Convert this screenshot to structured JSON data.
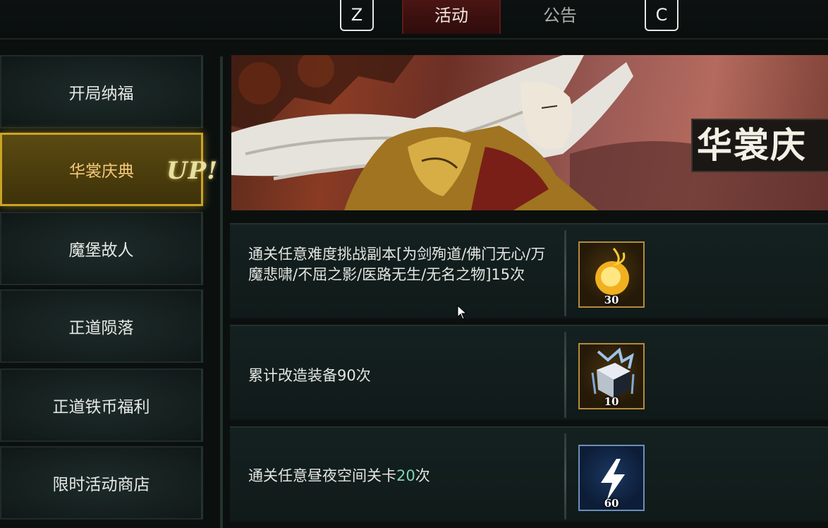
{
  "header": {
    "key_left": "Z",
    "key_right": "C",
    "tabs": [
      {
        "label": "活动",
        "active": true
      },
      {
        "label": "公告",
        "active": false
      }
    ]
  },
  "sidebar": {
    "items": [
      {
        "label": "开局纳福",
        "active": false
      },
      {
        "label": "华裳庆典",
        "active": true
      },
      {
        "label": "魔堡故人",
        "active": false
      },
      {
        "label": "正道陨落",
        "active": false
      },
      {
        "label": "正道铁币福利",
        "active": false
      },
      {
        "label": "限时活动商店",
        "active": false
      }
    ],
    "up_badge": "UP!"
  },
  "banner": {
    "title": "华裳庆"
  },
  "tasks": [
    {
      "description": "通关任意难度挑战副本[为剑殉道/佛门无心/万魔悲啸/不屈之影/医路无生/无名之物]15次",
      "reward_icon": "fire-orb-icon",
      "reward_count": "30"
    },
    {
      "description": "累计改造装备90次",
      "reward_icon": "crystal-cube-icon",
      "reward_count": "10"
    },
    {
      "description_prefix": "通关任意昼夜空间关卡",
      "description_highlight": "20",
      "description_suffix": "次",
      "reward_icon": "lightning-icon",
      "reward_count": "60"
    }
  ],
  "colors": {
    "active_tab": "#3c1110",
    "active_sidebar_border": "#c9a425",
    "active_sidebar_text": "#f5c97a",
    "highlight_number": "#7fd6b4"
  }
}
